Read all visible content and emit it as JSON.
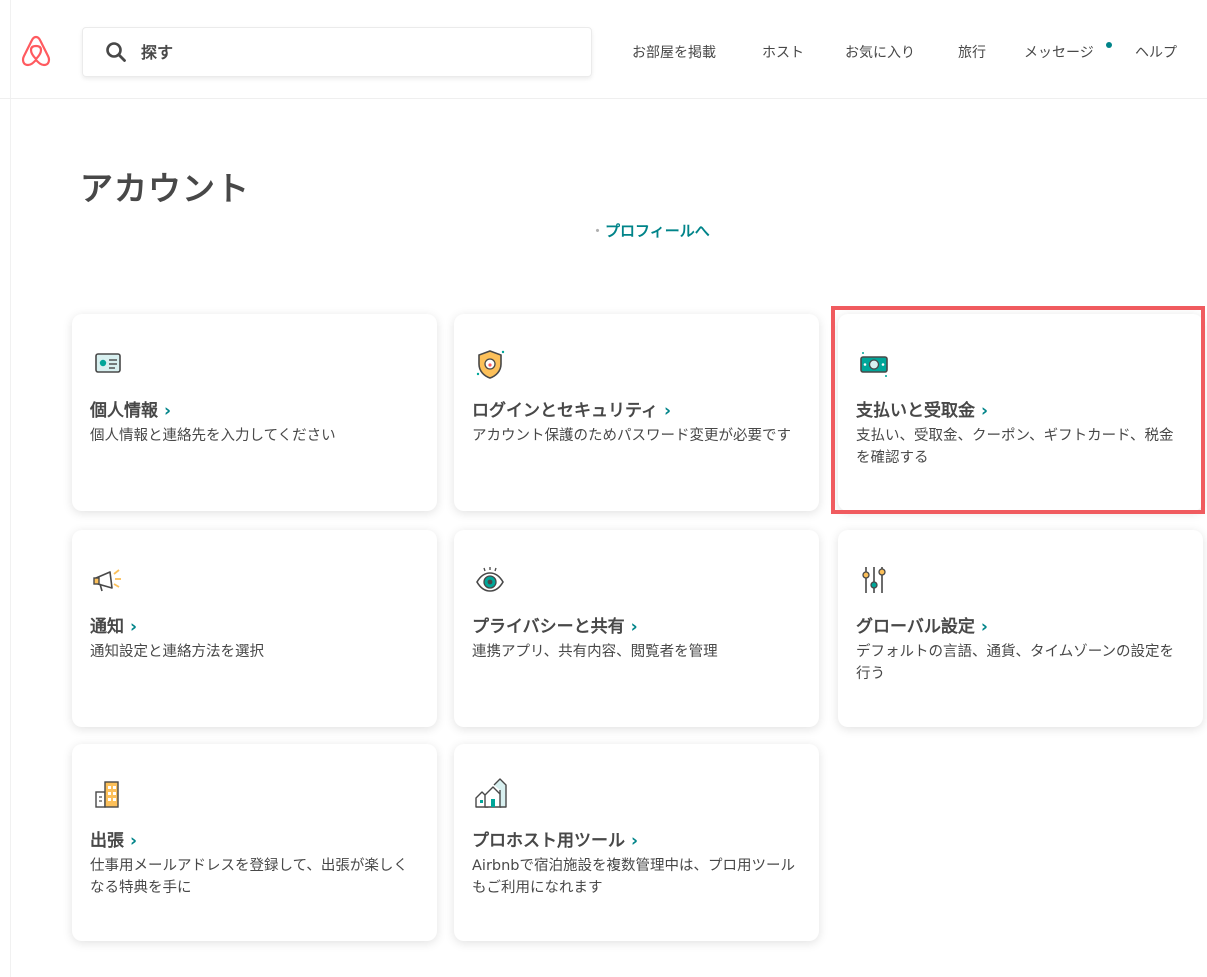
{
  "header": {
    "search_placeholder": "探す",
    "nav": [
      {
        "label": "お部屋を掲載"
      },
      {
        "label": "ホスト"
      },
      {
        "label": "お気に入り"
      },
      {
        "label": "旅行"
      },
      {
        "label": "メッセージ"
      },
      {
        "label": "ヘルプ"
      }
    ]
  },
  "page": {
    "title": "アカウント",
    "profile_prefix": "・",
    "profile_link": "プロフィールへ"
  },
  "cards": [
    {
      "title": "個人情報",
      "desc": "個人情報と連絡先を入力してください",
      "icon": "id-card-icon"
    },
    {
      "title": "ログインとセキュリティ",
      "desc": "アカウント保護のためパスワード変更が必要です",
      "icon": "shield-icon"
    },
    {
      "title": "支払いと受取金",
      "desc": "支払い、受取金、クーポン、ギフトカード、税金を確認する",
      "icon": "money-icon"
    },
    {
      "title": "通知",
      "desc": "通知設定と連絡方法を選択",
      "icon": "megaphone-icon"
    },
    {
      "title": "プライバシーと共有",
      "desc": "連携アプリ、共有内容、閲覧者を管理",
      "icon": "eye-icon"
    },
    {
      "title": "グローバル設定",
      "desc": "デフォルトの言語、通貨、タイムゾーンの設定を行う",
      "icon": "sliders-icon"
    },
    {
      "title": "出張",
      "desc": "仕事用メールアドレスを登録して、出張が楽しくなる特典を手に",
      "icon": "building-icon"
    },
    {
      "title": "プロホスト用ツール",
      "desc": "Airbnbで宿泊施設を複数管理中は、プロ用ツールもご利用になれます",
      "icon": "houses-icon"
    }
  ],
  "chevron": "›",
  "colors": {
    "brand": "#ff5a5f",
    "accent": "#008489",
    "highlight": "#f05b5f",
    "text": "#484848"
  }
}
